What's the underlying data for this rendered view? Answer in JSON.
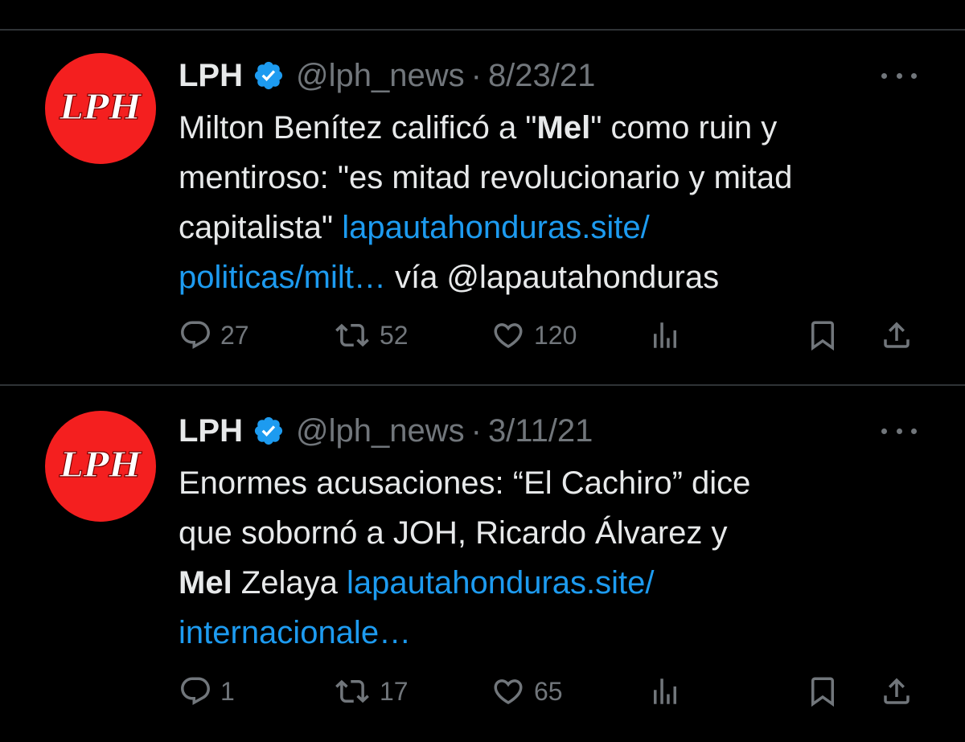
{
  "tweets": [
    {
      "avatar_text": "LPH",
      "name": "LPH",
      "handle": "@lph_news",
      "separator": "·",
      "date": "8/23/21",
      "text": {
        "line1_pre": "Milton Benítez calificó a \"",
        "line1_bold": "Mel",
        "line1_post": "\" como ruin y",
        "line2": "mentiroso: \"es mitad revolucionario y mitad",
        "line3_pre": "capitalista\" ",
        "line3_link": "lapautahonduras.site/",
        "line4_link": "politicas/milt…",
        "line4_post": " vía @lapautahonduras"
      },
      "stats": {
        "replies": "27",
        "reposts": "52",
        "likes": "120"
      }
    },
    {
      "avatar_text": "LPH",
      "name": "LPH",
      "handle": "@lph_news",
      "separator": "·",
      "date": "3/11/21",
      "text": {
        "line1": "Enormes acusaciones: “El Cachiro” dice",
        "line2": "que sobornó a JOH, Ricardo Álvarez y",
        "line3_bold": "Mel",
        "line3_pre_link": " Zelaya ",
        "line3_link": "lapautahonduras.site/",
        "line4_link": "internacionale…"
      },
      "stats": {
        "replies": "1",
        "reposts": "17",
        "likes": "65"
      }
    }
  ],
  "icons": {
    "reply": "reply-icon",
    "repost": "repost-icon",
    "like": "heart-icon",
    "views": "views-chart-icon",
    "bookmark": "bookmark-icon",
    "share": "share-icon",
    "verified": "verified-badge-icon",
    "more": "more-options-icon"
  },
  "colors": {
    "background": "#000000",
    "text": "#e7e9ea",
    "muted": "#71767b",
    "link": "#1d9bf0",
    "verified": "#1d9bf0",
    "avatar": "#f41f1f",
    "divider": "#2f3336"
  }
}
